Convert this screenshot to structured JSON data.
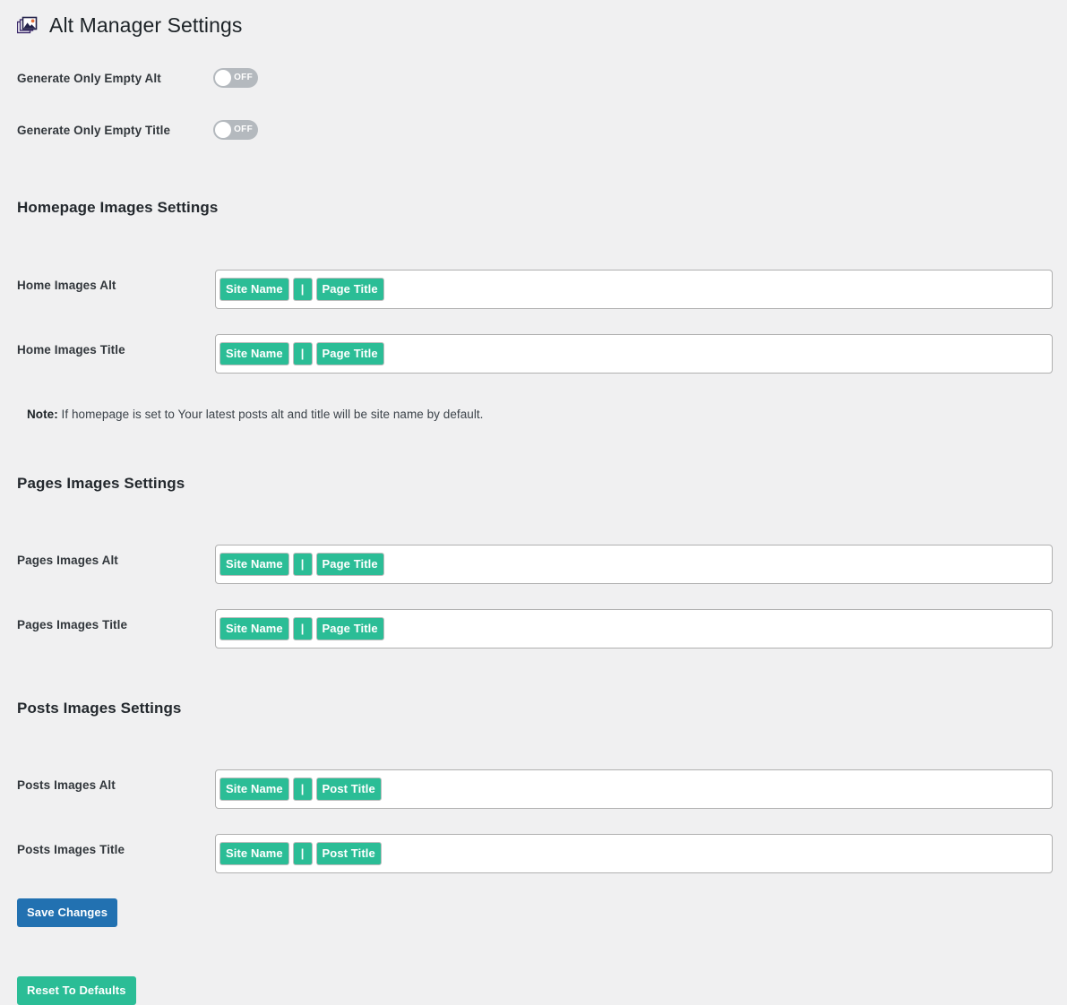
{
  "header": {
    "icon": "images-stack-icon",
    "title": "Alt Manager Settings"
  },
  "global_toggles": [
    {
      "label": "Generate Only Empty Alt",
      "state": "OFF",
      "on": false
    },
    {
      "label": "Generate Only Empty Title",
      "state": "OFF",
      "on": false
    }
  ],
  "sections": [
    {
      "heading": "Homepage Images Settings",
      "fields": [
        {
          "label": "Home Images Alt",
          "tokens": [
            "Site Name",
            "|",
            "Page Title"
          ]
        },
        {
          "label": "Home Images Title",
          "tokens": [
            "Site Name",
            "|",
            "Page Title"
          ]
        }
      ],
      "note_prefix": "Note:",
      "note_text": " If homepage is set to Your latest posts alt and title will be site name by default."
    },
    {
      "heading": "Pages Images Settings",
      "fields": [
        {
          "label": "Pages Images Alt",
          "tokens": [
            "Site Name",
            "|",
            "Page Title"
          ]
        },
        {
          "label": "Pages Images Title",
          "tokens": [
            "Site Name",
            "|",
            "Page Title"
          ]
        }
      ]
    },
    {
      "heading": "Posts Images Settings",
      "fields": [
        {
          "label": "Posts Images Alt",
          "tokens": [
            "Site Name",
            "|",
            "Post Title"
          ]
        },
        {
          "label": "Posts Images Title",
          "tokens": [
            "Site Name",
            "|",
            "Post Title"
          ]
        }
      ]
    }
  ],
  "actions": {
    "save_label": "Save Changes",
    "reset_label": "Reset To Defaults"
  },
  "colors": {
    "background": "#f0f0f1",
    "token_green": "#2bbd96",
    "primary_blue": "#2271b1",
    "toggle_off": "#b4b9be",
    "text": "#1d2327"
  }
}
